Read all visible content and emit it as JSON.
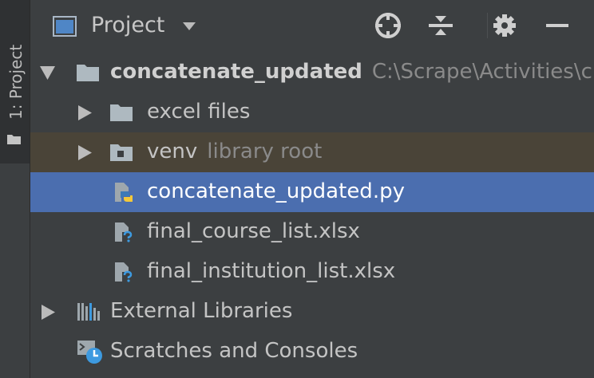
{
  "side_tab": {
    "label": "1: Project"
  },
  "header": {
    "title": "Project"
  },
  "tree": {
    "root": {
      "name": "concatenate_updated",
      "path": "C:\\Scrape\\Activities\\c"
    },
    "excel": {
      "name": "excel files"
    },
    "venv": {
      "name": "venv",
      "tag": "library root"
    },
    "py_file": {
      "name": "concatenate_updated.py"
    },
    "course": {
      "name": "final_course_list.xlsx"
    },
    "institution": {
      "name": "final_institution_list.xlsx"
    },
    "libraries": {
      "name": "External Libraries"
    },
    "scratches": {
      "name": "Scratches and Consoles"
    }
  },
  "colors": {
    "background": "#3c3f41",
    "selection": "#4b6eaf",
    "library_root_row": "#4a4438",
    "folder": "#aeb9c0",
    "python_blue": "#3d7ab8",
    "python_yellow": "#f4c83a"
  }
}
